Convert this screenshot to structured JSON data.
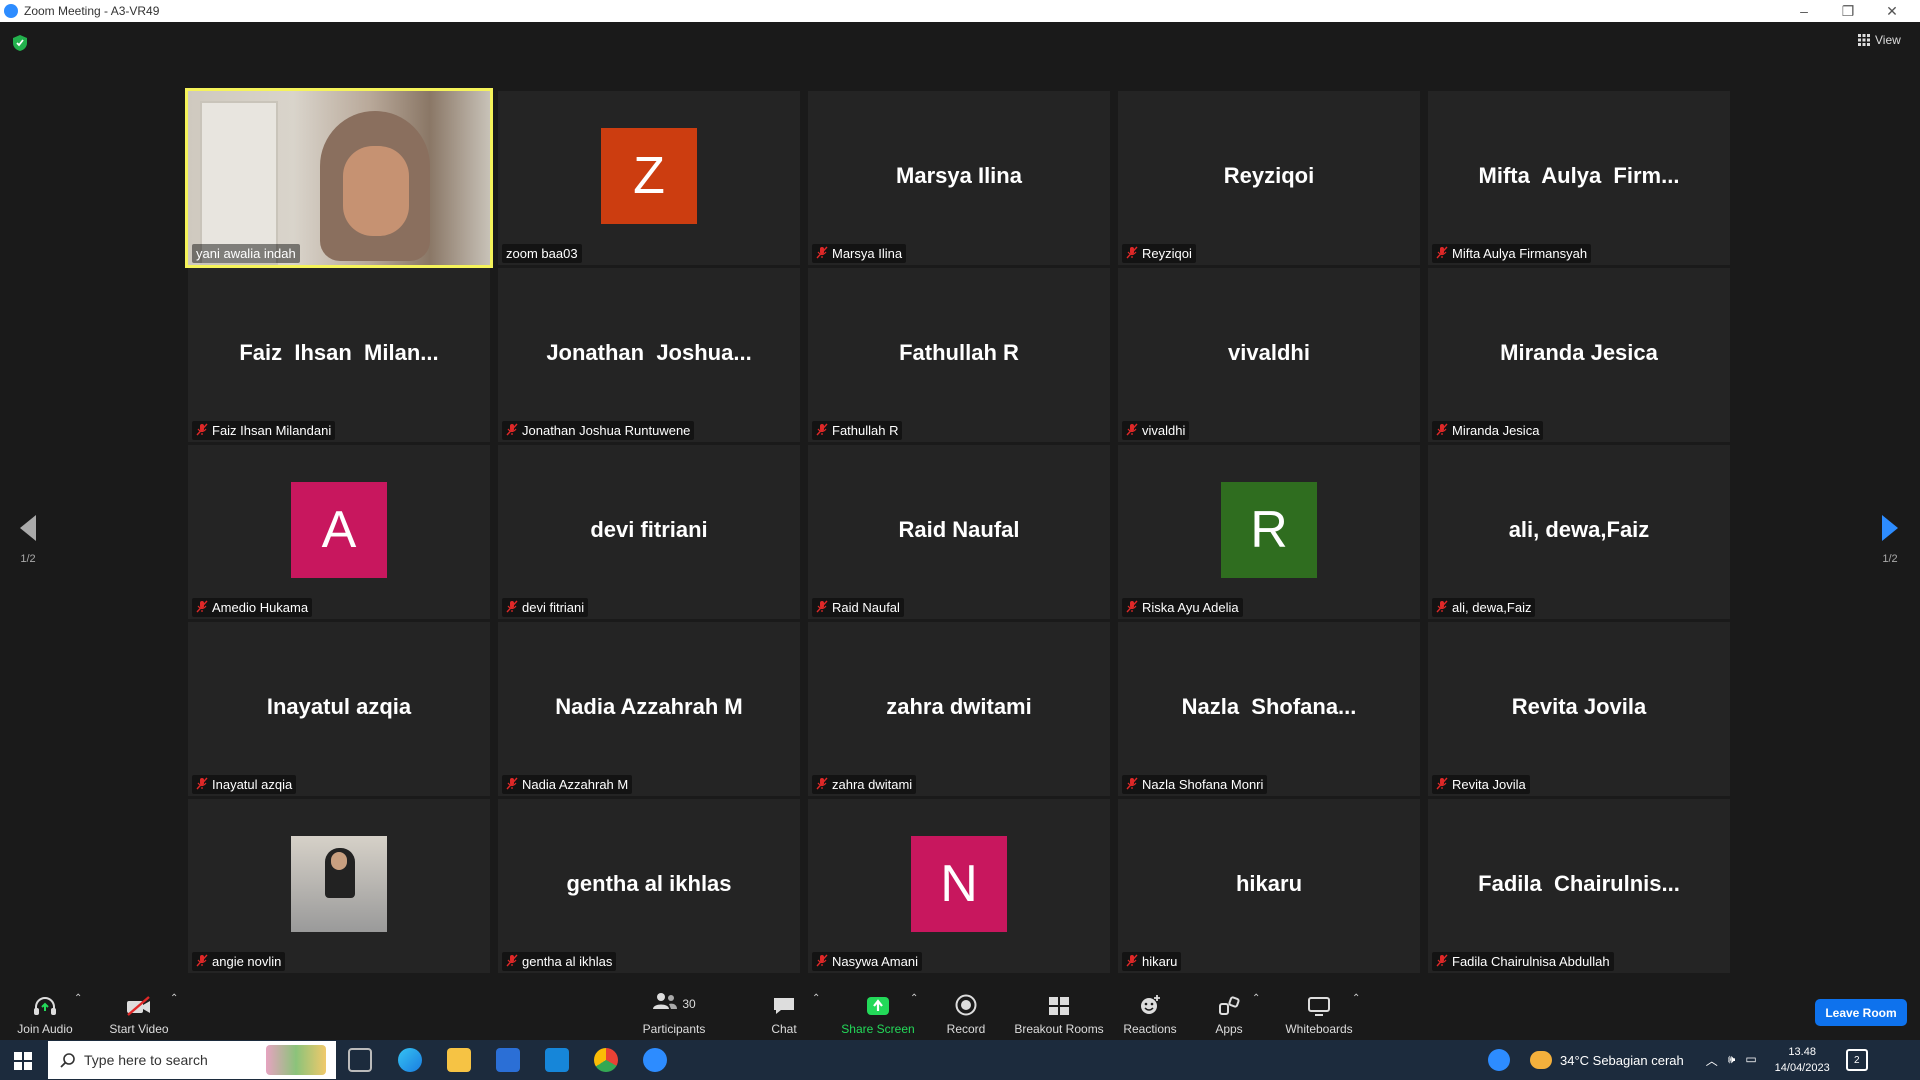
{
  "window": {
    "title": "Zoom Meeting - A3-VR49",
    "min": "–",
    "restore": "❐",
    "close": "✕"
  },
  "view_button": {
    "label": "View"
  },
  "pager": {
    "left": "1/2",
    "right": "1/2"
  },
  "tiles": [
    {
      "label": "yani awalia indah",
      "mode": "video",
      "muted": false,
      "active": true
    },
    {
      "label": "zoom baa03",
      "mode": "avatar",
      "letter": "Z",
      "color": "#cc3d10",
      "muted": false
    },
    {
      "label": "Marsya Ilina",
      "mode": "name",
      "display": "Marsya Ilina",
      "muted": true
    },
    {
      "label": "Reyziqoi",
      "mode": "name",
      "display": "Reyziqoi",
      "muted": true
    },
    {
      "label": "Mifta Aulya Firmansyah",
      "mode": "name",
      "display": "Mifta  Aulya  Firm...",
      "muted": true
    },
    {
      "label": "Faiz Ihsan Milandani",
      "mode": "name",
      "display": "Faiz  Ihsan  Milan...",
      "muted": true
    },
    {
      "label": "Jonathan Joshua Runtuwene",
      "mode": "name",
      "display": "Jonathan  Joshua...",
      "muted": true
    },
    {
      "label": "Fathullah R",
      "mode": "name",
      "display": "Fathullah R",
      "muted": true
    },
    {
      "label": "vivaldhi",
      "mode": "name",
      "display": "vivaldhi",
      "muted": true
    },
    {
      "label": "Miranda Jesica",
      "mode": "name",
      "display": "Miranda Jesica",
      "muted": true
    },
    {
      "label": "Amedio Hukama",
      "mode": "avatar",
      "letter": "A",
      "color": "#c8175e",
      "muted": true
    },
    {
      "label": "devi fitriani",
      "mode": "name",
      "display": "devi fitriani",
      "muted": true
    },
    {
      "label": "Raid Naufal",
      "mode": "name",
      "display": "Raid Naufal",
      "muted": true
    },
    {
      "label": "Riska Ayu Adelia",
      "mode": "avatar",
      "letter": "R",
      "color": "#2f6d1f",
      "muted": true
    },
    {
      "label": "ali, dewa,Faiz",
      "mode": "name",
      "display": "ali, dewa,Faiz",
      "muted": true
    },
    {
      "label": "Inayatul azqia",
      "mode": "name",
      "display": "Inayatul azqia",
      "muted": true
    },
    {
      "label": "Nadia Azzahrah M",
      "mode": "name",
      "display": "Nadia Azzahrah M",
      "muted": true
    },
    {
      "label": "zahra dwitami",
      "mode": "name",
      "display": "zahra dwitami",
      "muted": true
    },
    {
      "label": "Nazla Shofana Monri",
      "mode": "name",
      "display": "Nazla  Shofana...",
      "muted": true
    },
    {
      "label": "Revita Jovila",
      "mode": "name",
      "display": "Revita Jovila",
      "muted": true
    },
    {
      "label": "angie novlin",
      "mode": "photo",
      "muted": true
    },
    {
      "label": "gentha al ikhlas",
      "mode": "name",
      "display": "gentha al ikhlas",
      "muted": true
    },
    {
      "label": "Nasywa Amani",
      "mode": "avatar",
      "letter": "N",
      "color": "#c8175e",
      "muted": true
    },
    {
      "label": "hikaru",
      "mode": "name",
      "display": "hikaru",
      "muted": true
    },
    {
      "label": "Fadila Chairulnisa Abdullah",
      "mode": "name",
      "display": "Fadila  Chairulnis...",
      "muted": true
    }
  ],
  "toolbar": {
    "join_audio": "Join Audio",
    "start_video": "Start Video",
    "participants": "Participants",
    "participants_count": "30",
    "chat": "Chat",
    "share_screen": "Share Screen",
    "record": "Record",
    "breakout_rooms": "Breakout Rooms",
    "reactions": "Reactions",
    "apps": "Apps",
    "whiteboards": "Whiteboards",
    "leave_room": "Leave Room",
    "caret": "⌃"
  },
  "taskbar": {
    "search_placeholder": "Type here to search",
    "weather": "34°C  Sebagian cerah",
    "time": "13.48",
    "date": "14/04/2023",
    "notifications": "2"
  },
  "colors": {
    "accent": "#0e72ed",
    "share_green": "#23d959",
    "mute_red": "#e02828",
    "active_border": "#f5f35a"
  }
}
